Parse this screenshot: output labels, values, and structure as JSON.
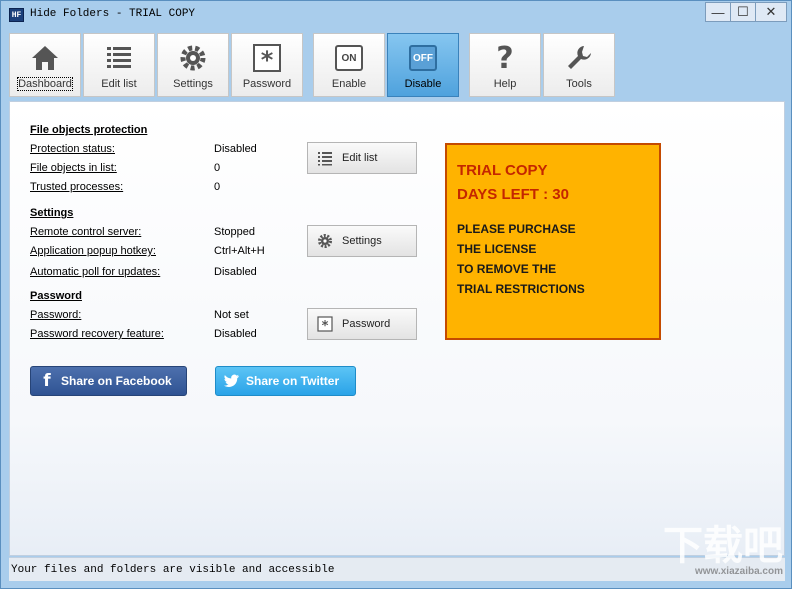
{
  "window": {
    "title": "Hide Folders - TRIAL COPY",
    "app_icon_text": "HF",
    "minimize": "—",
    "maximize": "☐",
    "close": "✕"
  },
  "toolbar": {
    "buttons": [
      {
        "label": "Dashboard",
        "icon": "home-icon"
      },
      {
        "label": "Edit list",
        "icon": "list-icon"
      },
      {
        "label": "Settings",
        "icon": "gear-icon"
      },
      {
        "label": "Password",
        "icon": "asterisk-icon"
      },
      {
        "label": "Enable",
        "icon": "on-icon",
        "icon_text": "ON"
      },
      {
        "label": "Disable",
        "icon": "off-icon",
        "icon_text": "OFF"
      },
      {
        "label": "Help",
        "icon": "question-icon",
        "icon_text": "?"
      },
      {
        "label": "Tools",
        "icon": "wrench-icon"
      }
    ],
    "active": "Disable"
  },
  "sections": {
    "protection": {
      "title": "File objects protection",
      "rows": [
        {
          "label": "Protection status:",
          "value": "Disabled"
        },
        {
          "label": "File objects in list:",
          "value": "0"
        },
        {
          "label": "Trusted processes:",
          "value": "0"
        }
      ],
      "button": "Edit list"
    },
    "settings": {
      "title": "Settings",
      "rows": [
        {
          "label": "Remote control server:",
          "value": "Stopped"
        },
        {
          "label": "Application popup hotkey:",
          "value": "Ctrl+Alt+H"
        },
        {
          "label": "Automatic poll for updates:",
          "value": "Disabled"
        }
      ],
      "button": "Settings"
    },
    "password": {
      "title": "Password",
      "rows": [
        {
          "label": "Password:",
          "value": "Not set"
        },
        {
          "label": "Password recovery feature:",
          "value": "Disabled"
        }
      ],
      "button": "Password"
    }
  },
  "trial": {
    "line1": "TRIAL COPY",
    "line2": "DAYS LEFT : 30",
    "body": [
      "PLEASE PURCHASE",
      "THE LICENSE",
      "TO REMOVE THE",
      "TRIAL RESTRICTIONS"
    ]
  },
  "share": {
    "facebook": "Share on Facebook",
    "twitter": "Share on Twitter"
  },
  "status": "Your files and folders are visible and accessible",
  "watermark": {
    "text": "下载吧",
    "url": "www.xiazaiba.com"
  },
  "colors": {
    "accent": "#4fa2dd",
    "trial_bg": "#ffb300",
    "trial_border": "#c44a00",
    "trial_head": "#c42600",
    "facebook": "#3b5998",
    "twitter": "#2aa3e8"
  }
}
